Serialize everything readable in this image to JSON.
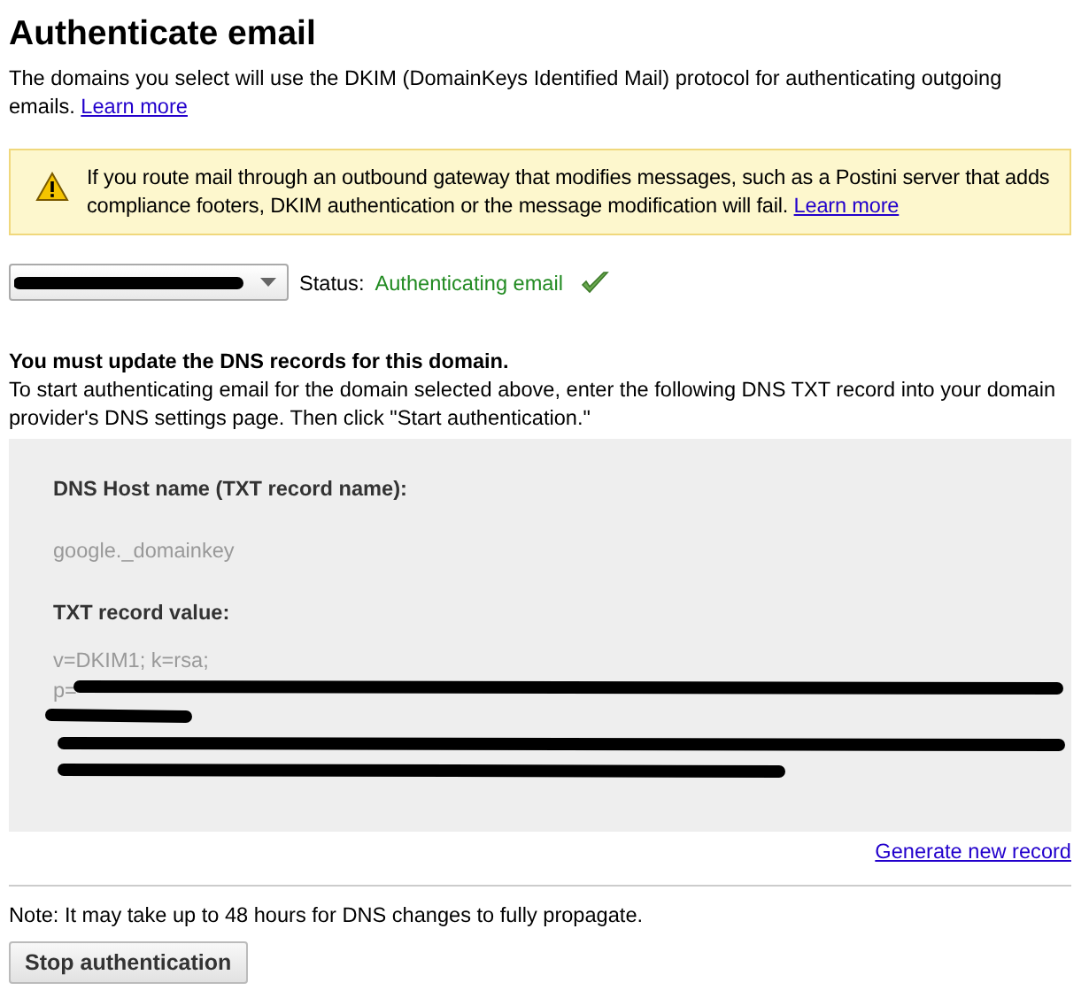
{
  "title": "Authenticate email",
  "intro": {
    "text": "The domains you select will use the DKIM (DomainKeys Identified Mail) protocol for authenticating outgoing emails.",
    "link": "Learn more"
  },
  "warning": {
    "text": "If you route mail through an outbound gateway that modifies messages, such as a Postini server that adds compliance footers, DKIM authentication or the message modification will fail.",
    "link": "Learn more"
  },
  "status": {
    "label": "Status:",
    "value": "Authenticating email",
    "ok": true
  },
  "instructions": {
    "heading": "You must update the DNS records for this domain.",
    "text": "To start authenticating email for the domain selected above, enter the following DNS TXT record into your domain provider's DNS settings page. Then click \"Start authentication.\""
  },
  "record": {
    "host_label": "DNS Host name (TXT record name):",
    "host_value": "google._domainkey",
    "value_label": "TXT record value:",
    "value_lines": [
      "v=DKIM1; k=rsa;",
      "p="
    ]
  },
  "generate_link": "Generate new record",
  "note": "Note: It may take up to 48 hours for DNS changes to fully propagate.",
  "button": "Stop authentication"
}
